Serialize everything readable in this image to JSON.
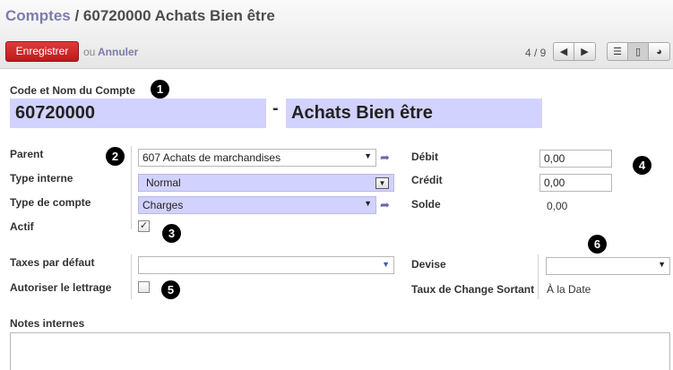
{
  "header": {
    "breadcrumb_parent": "Comptes",
    "breadcrumb_sep": " / ",
    "breadcrumb_current": "60720000 Achats Bien être",
    "save_label": "Enregistrer",
    "or_text": "ou",
    "cancel_label": "Annuler",
    "pager": "4 / 9"
  },
  "account": {
    "code_name_label": "Code et Nom du Compte",
    "code": "60720000",
    "separator": "-",
    "name": "Achats Bien être"
  },
  "fields": {
    "parent_label": "Parent",
    "parent_value": "607 Achats de marchandises",
    "internal_type_label": "Type interne",
    "internal_type_value": "Normal",
    "account_type_label": "Type de compte",
    "account_type_value": "Charges",
    "active_label": "Actif",
    "active_checked": true,
    "default_taxes_label": "Taxes par défaut",
    "default_taxes_value": "",
    "reconcile_label": "Autoriser le lettrage",
    "reconcile_checked": false,
    "debit_label": "Débit",
    "debit_value": "0,00",
    "credit_label": "Crédit",
    "credit_value": "0,00",
    "balance_label": "Solde",
    "balance_value": "0,00",
    "currency_label": "Devise",
    "currency_value": "",
    "exchange_rate_label": "Taux de Change Sortant",
    "exchange_rate_value": "À la Date"
  },
  "notes": {
    "label": "Notes internes",
    "value": ""
  },
  "badges": [
    "1",
    "2",
    "3",
    "4",
    "5",
    "6"
  ],
  "icons": {
    "prev": "arrow-left-icon",
    "next": "arrow-right-icon",
    "list_view": "list-view-icon",
    "form_view": "form-view-icon",
    "graph_view": "graph-view-icon",
    "external": "external-link-icon"
  },
  "colors": {
    "primary_button": "#c9302c",
    "link": "#7c7bad",
    "required_field": "#d2d2ff"
  }
}
